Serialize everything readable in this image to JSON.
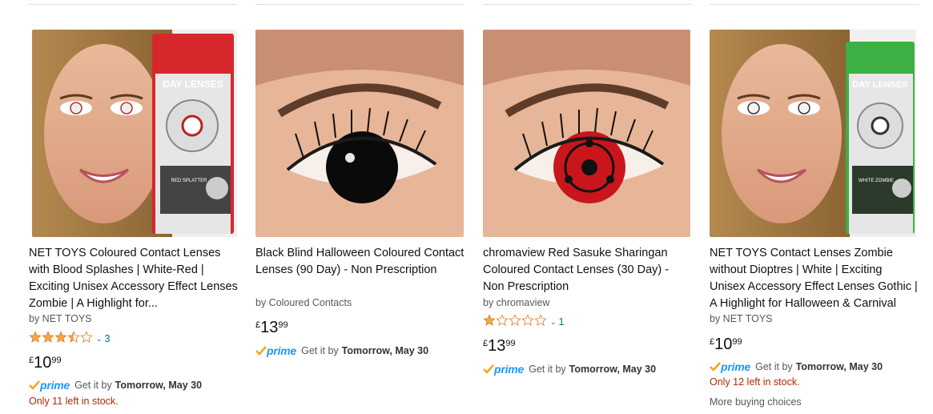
{
  "products": [
    {
      "title": "NET TOYS Coloured Contact Lenses with Blood Splashes | White-Red | Exciting Unisex Accessory Effect Lenses Zombie | A Highlight for...",
      "byline": "by NET TOYS",
      "rating_stars": 3.5,
      "rating_count": "3",
      "price_currency": "£",
      "price_whole": "10",
      "price_fraction": "99",
      "prime": "prime",
      "delivery_prefix": "Get it by",
      "delivery_date": "Tomorrow, May 30",
      "stock": "Only 11 left in stock.",
      "more": "",
      "image": {
        "kind": "model-with-box",
        "box_label": "DAY LENSES",
        "box_sub": "LENTILLES JOURNALIÈRES TAGES-LINSEN",
        "box_variant": "RED SPLATTER",
        "accent": "#d8262d"
      }
    },
    {
      "title": "Black Blind Halloween Coloured Contact Lenses (90 Day) - Non Prescription",
      "byline": "by Coloured Contacts",
      "rating_stars": null,
      "rating_count": "",
      "price_currency": "£",
      "price_whole": "13",
      "price_fraction": "99",
      "prime": "prime",
      "delivery_prefix": "Get it by",
      "delivery_date": "Tomorrow, May 30",
      "stock": "",
      "more": "",
      "image": {
        "kind": "eye-closeup",
        "iris": "#0a0a0a"
      }
    },
    {
      "title": "chromaview Red Sasuke Sharingan Coloured Contact Lenses (30 Day) - Non Prescription",
      "byline": "by chromaview",
      "rating_stars": 1,
      "rating_count": "1",
      "price_currency": "£",
      "price_whole": "13",
      "price_fraction": "99",
      "prime": "prime",
      "delivery_prefix": "Get it by",
      "delivery_date": "Tomorrow, May 30",
      "stock": "",
      "more": "",
      "image": {
        "kind": "eye-closeup",
        "iris": "#c8161c"
      }
    },
    {
      "title": "NET TOYS Contact Lenses Zombie without Dioptres | White | Exciting Unisex Accessory Effect Lenses Gothic | A Highlight for Halloween & Carnival",
      "byline": "by NET TOYS",
      "rating_stars": null,
      "rating_count": "",
      "price_currency": "£",
      "price_whole": "10",
      "price_fraction": "99",
      "prime": "prime",
      "delivery_prefix": "Get it by",
      "delivery_date": "Tomorrow, May 30",
      "stock": "Only 12 left in stock.",
      "more": "More buying choices",
      "image": {
        "kind": "model-with-box",
        "box_label": "DAY LENSES",
        "box_sub": "LENTILLES JOURNALIÈRES TAGES-LINSEN",
        "box_variant": "WHITE ZOMBIE",
        "accent": "#3cb043"
      }
    }
  ],
  "colors": {
    "link": "#007185",
    "prime_blue": "#1a98ff",
    "prime_check": "#f7a41d",
    "stock_red": "#b12704",
    "star": "#f3a847"
  }
}
